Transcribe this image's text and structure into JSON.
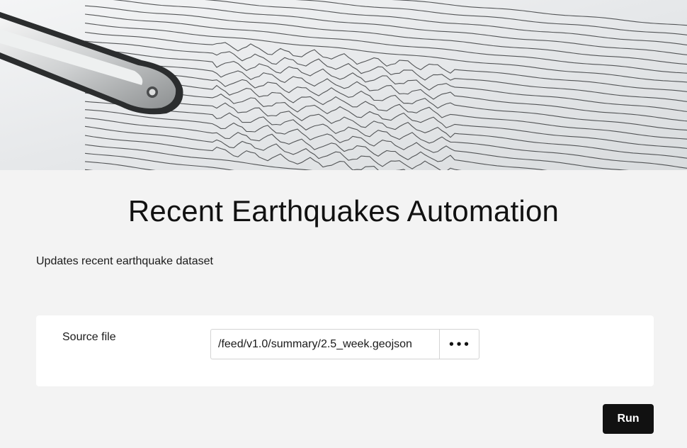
{
  "hero": {
    "image": "seismograph-photo"
  },
  "page": {
    "title": "Recent Earthquakes Automation",
    "description": "Updates recent earthquake dataset"
  },
  "form": {
    "source_file_label": "Source file",
    "source_file_value": "/feed/v1.0/summary/2.5_week.geojson",
    "browse_label": "•••"
  },
  "actions": {
    "run_label": "Run"
  },
  "colors": {
    "page_bg": "#f3f3f3",
    "card_bg": "#ffffff",
    "button_bg": "#111111",
    "button_text": "#ffffff"
  }
}
